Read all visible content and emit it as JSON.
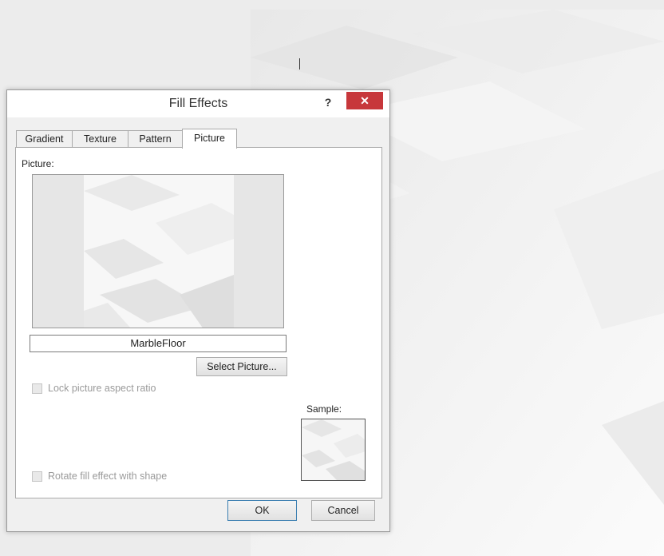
{
  "dialog": {
    "title": "Fill Effects",
    "help_label": "?",
    "close_label": "✕",
    "tabs": [
      {
        "label": "Gradient"
      },
      {
        "label": "Texture"
      },
      {
        "label": "Pattern"
      },
      {
        "label": "Picture",
        "active": true
      }
    ],
    "picture_label": "Picture:",
    "picture_name": "MarbleFloor",
    "select_picture_label": "Select Picture...",
    "lock_aspect_label": "Lock picture aspect ratio",
    "rotate_label": "Rotate fill effect with shape",
    "sample_label": "Sample:",
    "ok_label": "OK",
    "cancel_label": "Cancel"
  },
  "colors": {
    "close_button": "#c7373b",
    "ok_border": "#3c7fb1",
    "dialog_bg": "#f0f0f0"
  }
}
